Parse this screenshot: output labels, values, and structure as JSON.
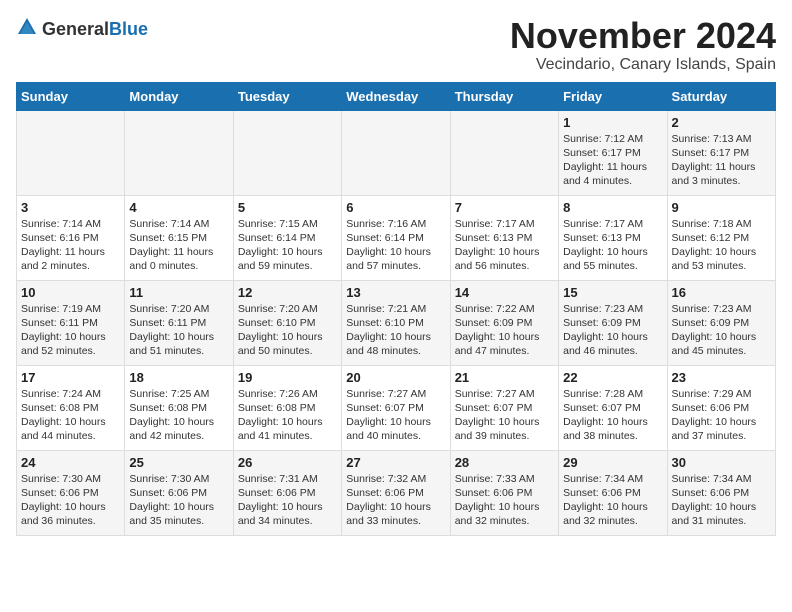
{
  "header": {
    "logo_general": "General",
    "logo_blue": "Blue",
    "title": "November 2024",
    "subtitle": "Vecindario, Canary Islands, Spain"
  },
  "columns": [
    "Sunday",
    "Monday",
    "Tuesday",
    "Wednesday",
    "Thursday",
    "Friday",
    "Saturday"
  ],
  "weeks": [
    [
      {
        "day": "",
        "info": ""
      },
      {
        "day": "",
        "info": ""
      },
      {
        "day": "",
        "info": ""
      },
      {
        "day": "",
        "info": ""
      },
      {
        "day": "",
        "info": ""
      },
      {
        "day": "1",
        "info": "Sunrise: 7:12 AM\nSunset: 6:17 PM\nDaylight: 11 hours\nand 4 minutes."
      },
      {
        "day": "2",
        "info": "Sunrise: 7:13 AM\nSunset: 6:17 PM\nDaylight: 11 hours\nand 3 minutes."
      }
    ],
    [
      {
        "day": "3",
        "info": "Sunrise: 7:14 AM\nSunset: 6:16 PM\nDaylight: 11 hours\nand 2 minutes."
      },
      {
        "day": "4",
        "info": "Sunrise: 7:14 AM\nSunset: 6:15 PM\nDaylight: 11 hours\nand 0 minutes."
      },
      {
        "day": "5",
        "info": "Sunrise: 7:15 AM\nSunset: 6:14 PM\nDaylight: 10 hours\nand 59 minutes."
      },
      {
        "day": "6",
        "info": "Sunrise: 7:16 AM\nSunset: 6:14 PM\nDaylight: 10 hours\nand 57 minutes."
      },
      {
        "day": "7",
        "info": "Sunrise: 7:17 AM\nSunset: 6:13 PM\nDaylight: 10 hours\nand 56 minutes."
      },
      {
        "day": "8",
        "info": "Sunrise: 7:17 AM\nSunset: 6:13 PM\nDaylight: 10 hours\nand 55 minutes."
      },
      {
        "day": "9",
        "info": "Sunrise: 7:18 AM\nSunset: 6:12 PM\nDaylight: 10 hours\nand 53 minutes."
      }
    ],
    [
      {
        "day": "10",
        "info": "Sunrise: 7:19 AM\nSunset: 6:11 PM\nDaylight: 10 hours\nand 52 minutes."
      },
      {
        "day": "11",
        "info": "Sunrise: 7:20 AM\nSunset: 6:11 PM\nDaylight: 10 hours\nand 51 minutes."
      },
      {
        "day": "12",
        "info": "Sunrise: 7:20 AM\nSunset: 6:10 PM\nDaylight: 10 hours\nand 50 minutes."
      },
      {
        "day": "13",
        "info": "Sunrise: 7:21 AM\nSunset: 6:10 PM\nDaylight: 10 hours\nand 48 minutes."
      },
      {
        "day": "14",
        "info": "Sunrise: 7:22 AM\nSunset: 6:09 PM\nDaylight: 10 hours\nand 47 minutes."
      },
      {
        "day": "15",
        "info": "Sunrise: 7:23 AM\nSunset: 6:09 PM\nDaylight: 10 hours\nand 46 minutes."
      },
      {
        "day": "16",
        "info": "Sunrise: 7:23 AM\nSunset: 6:09 PM\nDaylight: 10 hours\nand 45 minutes."
      }
    ],
    [
      {
        "day": "17",
        "info": "Sunrise: 7:24 AM\nSunset: 6:08 PM\nDaylight: 10 hours\nand 44 minutes."
      },
      {
        "day": "18",
        "info": "Sunrise: 7:25 AM\nSunset: 6:08 PM\nDaylight: 10 hours\nand 42 minutes."
      },
      {
        "day": "19",
        "info": "Sunrise: 7:26 AM\nSunset: 6:08 PM\nDaylight: 10 hours\nand 41 minutes."
      },
      {
        "day": "20",
        "info": "Sunrise: 7:27 AM\nSunset: 6:07 PM\nDaylight: 10 hours\nand 40 minutes."
      },
      {
        "day": "21",
        "info": "Sunrise: 7:27 AM\nSunset: 6:07 PM\nDaylight: 10 hours\nand 39 minutes."
      },
      {
        "day": "22",
        "info": "Sunrise: 7:28 AM\nSunset: 6:07 PM\nDaylight: 10 hours\nand 38 minutes."
      },
      {
        "day": "23",
        "info": "Sunrise: 7:29 AM\nSunset: 6:06 PM\nDaylight: 10 hours\nand 37 minutes."
      }
    ],
    [
      {
        "day": "24",
        "info": "Sunrise: 7:30 AM\nSunset: 6:06 PM\nDaylight: 10 hours\nand 36 minutes."
      },
      {
        "day": "25",
        "info": "Sunrise: 7:30 AM\nSunset: 6:06 PM\nDaylight: 10 hours\nand 35 minutes."
      },
      {
        "day": "26",
        "info": "Sunrise: 7:31 AM\nSunset: 6:06 PM\nDaylight: 10 hours\nand 34 minutes."
      },
      {
        "day": "27",
        "info": "Sunrise: 7:32 AM\nSunset: 6:06 PM\nDaylight: 10 hours\nand 33 minutes."
      },
      {
        "day": "28",
        "info": "Sunrise: 7:33 AM\nSunset: 6:06 PM\nDaylight: 10 hours\nand 32 minutes."
      },
      {
        "day": "29",
        "info": "Sunrise: 7:34 AM\nSunset: 6:06 PM\nDaylight: 10 hours\nand 32 minutes."
      },
      {
        "day": "30",
        "info": "Sunrise: 7:34 AM\nSunset: 6:06 PM\nDaylight: 10 hours\nand 31 minutes."
      }
    ]
  ]
}
